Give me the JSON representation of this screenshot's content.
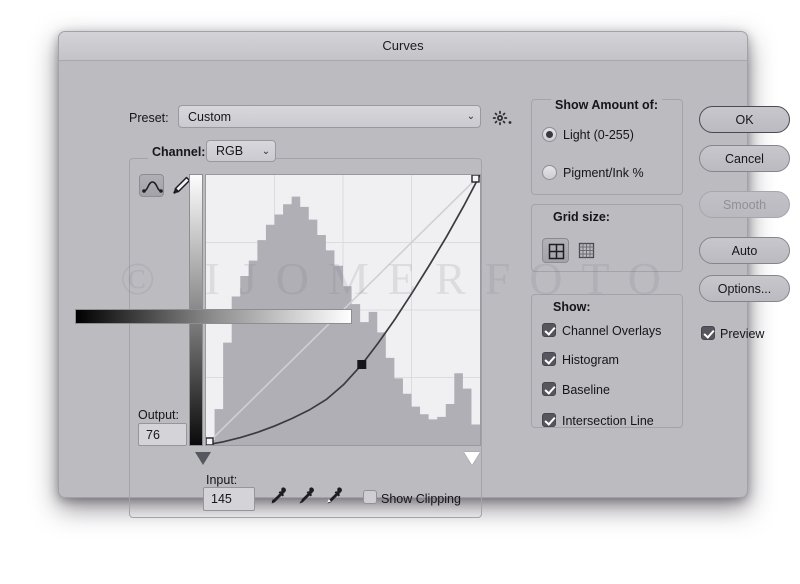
{
  "window": {
    "title": "Curves"
  },
  "watermark": "© IJOMERFOTO",
  "preset": {
    "label": "Preset:",
    "value": "Custom",
    "carat": "⌄",
    "gear_icon": "gear-icon"
  },
  "channel": {
    "label": "Channel:",
    "value": "RGB",
    "carat": "⌄"
  },
  "tools": {
    "curve_icon": "curve-point-tool-icon",
    "pencil_icon": "pencil-tool-icon",
    "curve_display_options_icon": "curve-display-options-icon"
  },
  "fields": {
    "output_label": "Output:",
    "output_value": "76",
    "input_label": "Input:",
    "input_value": "145"
  },
  "droppers": {
    "black": "black-point-eyedropper-icon",
    "gray": "gray-point-eyedropper-icon",
    "white": "white-point-eyedropper-icon"
  },
  "clipping": {
    "label": "Show Clipping",
    "checked": false
  },
  "show_amount": {
    "title": "Show Amount of:",
    "options": [
      {
        "label": "Light  (0-255)",
        "selected": true
      },
      {
        "label": "Pigment/Ink %",
        "selected": false
      }
    ]
  },
  "grid_size": {
    "title": "Grid size:",
    "options": [
      {
        "name": "grid-4x4",
        "selected": true
      },
      {
        "name": "grid-10x10",
        "selected": false
      }
    ]
  },
  "show": {
    "title": "Show:",
    "items": [
      {
        "label": "Channel Overlays",
        "checked": true
      },
      {
        "label": "Histogram",
        "checked": true
      },
      {
        "label": "Baseline",
        "checked": true
      },
      {
        "label": "Intersection Line",
        "checked": true
      }
    ]
  },
  "buttons": {
    "ok": "OK",
    "cancel": "Cancel",
    "smooth": "Smooth",
    "auto": "Auto",
    "options": "Options..."
  },
  "preview": {
    "label": "Preview",
    "checked": true
  },
  "chart_data": {
    "type": "line",
    "title": "Curves tone curve with RGB histogram",
    "xlabel": "Input (0-255)",
    "ylabel": "Output (0-255)",
    "xlim": [
      0,
      255
    ],
    "ylim": [
      0,
      255
    ],
    "grid": true,
    "grid_divisions": 4,
    "series": [
      {
        "name": "baseline",
        "type": "line",
        "x": [
          0,
          255
        ],
        "y": [
          0,
          255
        ]
      },
      {
        "name": "tone-curve",
        "type": "line",
        "control_points": [
          {
            "x": 0,
            "y": 0
          },
          {
            "x": 145,
            "y": 76
          },
          {
            "x": 255,
            "y": 255
          }
        ],
        "x": [
          0,
          16,
          32,
          48,
          64,
          80,
          96,
          112,
          128,
          145,
          160,
          176,
          192,
          208,
          224,
          240,
          255
        ],
        "y": [
          0,
          3,
          7,
          12,
          18,
          25,
          33,
          43,
          57,
          76,
          96,
          119,
          144,
          170,
          197,
          226,
          255
        ]
      }
    ],
    "histogram": {
      "name": "rgb-histogram",
      "bin_count": 32,
      "values": [
        2,
        14,
        40,
        58,
        66,
        72,
        80,
        86,
        90,
        94,
        97,
        93,
        88,
        82,
        76,
        70,
        62,
        55,
        48,
        52,
        44,
        34,
        26,
        20,
        15,
        12,
        10,
        11,
        16,
        28,
        22,
        8
      ]
    }
  }
}
